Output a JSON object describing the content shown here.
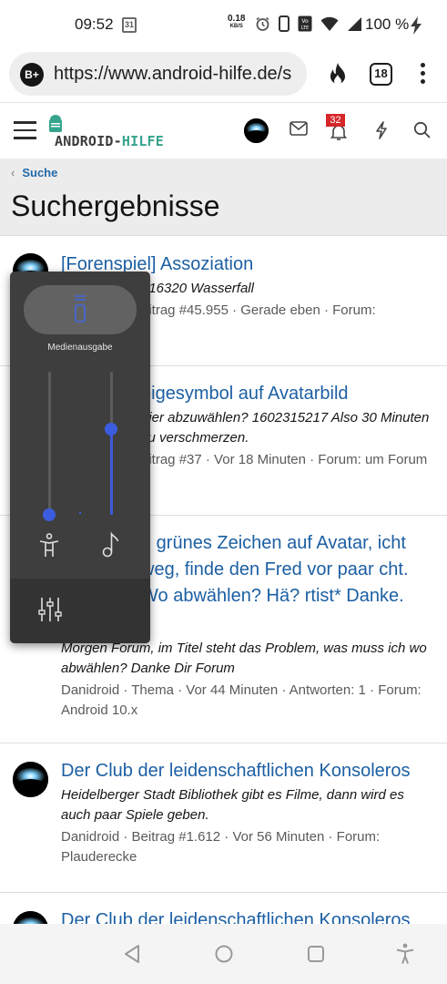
{
  "status_bar": {
    "time": "09:52",
    "calendar_day": "31",
    "net_speed_value": "0.18",
    "net_speed_unit": "KB/S",
    "battery": "100 %",
    "icons": [
      "calendar-icon",
      "alarm-icon",
      "phone-icon",
      "volte-icon",
      "wifi-icon",
      "signal-icon",
      "charging-icon"
    ]
  },
  "browser": {
    "profile_badge": "B+",
    "url": "https://www.android-hilfe.de/se",
    "tab_count": "18",
    "icons": [
      "fire-icon",
      "tabs-icon",
      "overflow-menu-icon"
    ]
  },
  "site_header": {
    "logo_part1": "ANDROID-",
    "logo_part2": "HILFE",
    "notification_count": "32",
    "colors": {
      "logo_green": "#37a48d",
      "badge_red": "#d6262a"
    }
  },
  "page": {
    "breadcrumb": "Suche",
    "title": "Suchergebnisse"
  },
  "results": [
    {
      "title": "[Forenspiel] Assoziation",
      "snippet": "316320 Wasserfall",
      "meta": "eitrag #45.955 · Gerade eben · Forum:"
    },
    {
      "title": "eigesymbol auf Avatarbild",
      "snippet": "hier abzuwählen? 1602315217 Also 30 Minuten zu verschmerzen.",
      "meta": "eitrag #37 · Vor 18 Minuten · Forum: um Forum"
    },
    {
      "title": "h grünes Zeichen auf Avatar, icht weg, finde den Fred vor paar cht. Wo abwählen? Hä? rtist* Danke.",
      "snippet": "Morgen Forum, im Titel steht das Problem, was muss ich wo abwählen? Danke Dir Forum",
      "meta": "Danidroid · Thema · Vor 44 Minuten · Antworten: 1 · Forum: Android 10.x"
    },
    {
      "title": "Der Club der leidenschaftlichen Konsoleros",
      "snippet": "Heidelberger Stadt Bibliothek gibt es Filme, dann wird es auch paar Spiele geben.",
      "meta": "Danidroid · Beitrag #1.612 · Vor 56 Minuten · Forum: Plauderecke"
    },
    {
      "title": "Der Club der leidenschaftlichen Konsoleros",
      "snippet": "",
      "meta": ""
    }
  ],
  "volume_panel": {
    "label": "Medienausgabe",
    "accessibility_level": 0.0,
    "media_level": 0.6,
    "icons": [
      "vibrate-mode-icon",
      "accessibility-volume-icon",
      "music-note-icon",
      "equalizer-settings-icon"
    ],
    "accent_color": "#3c5ce0"
  },
  "nav_bar": {
    "icons": [
      "back-icon",
      "home-icon",
      "recents-icon",
      "accessibility-icon"
    ]
  }
}
